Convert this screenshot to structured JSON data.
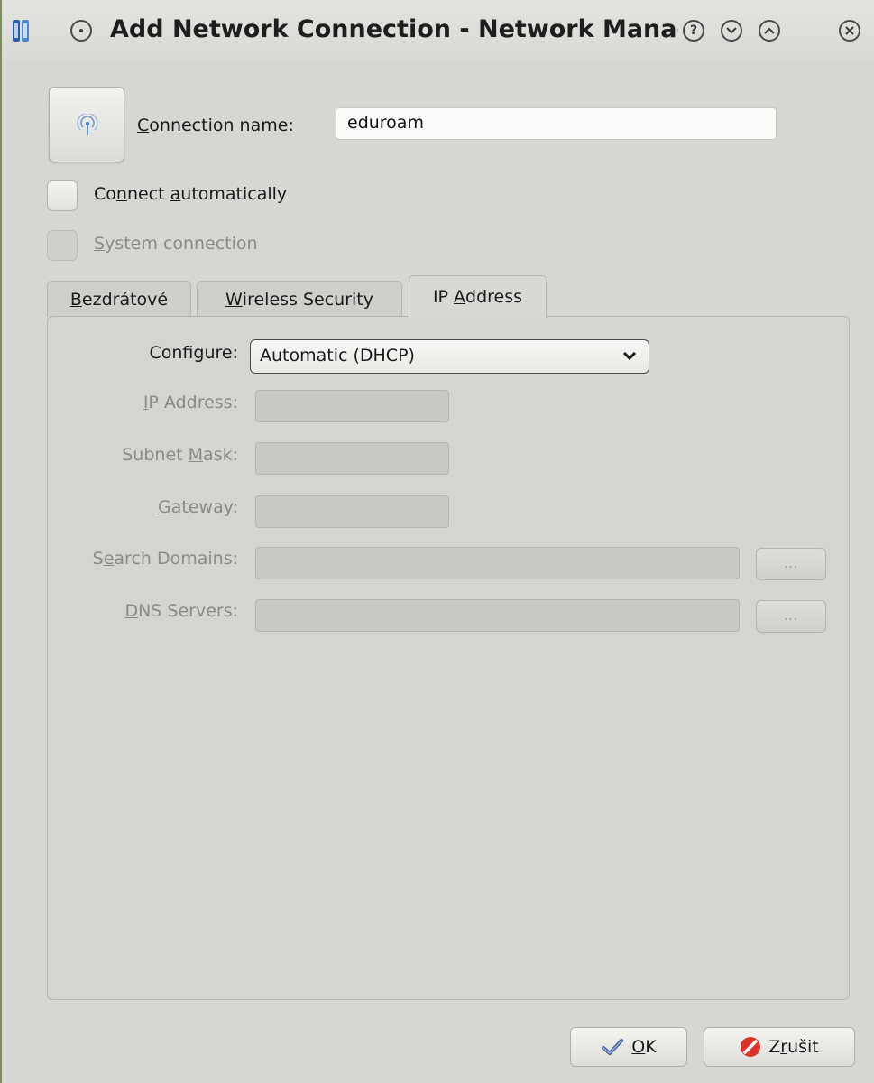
{
  "window": {
    "title": "Add Network Connection - Network Manag",
    "icons": [
      "app-icon",
      "menu-icon",
      "help-icon",
      "minimize-icon",
      "maximize-icon",
      "close-icon"
    ]
  },
  "connection": {
    "icon": "wireless-icon",
    "name_label_u": "C",
    "name_label_rest": "onnection name:",
    "name_value": "eduroam"
  },
  "options": {
    "connect_auto_pre": "Co",
    "connect_auto_u1": "n",
    "connect_auto_mid": "nect ",
    "connect_auto_u2": "a",
    "connect_auto_post": "utomatically",
    "system_conn_u": "S",
    "system_conn_rest": "ystem connection"
  },
  "tabs": [
    {
      "u": "B",
      "rest": "ezdrátové"
    },
    {
      "u": "W",
      "rest": "ireless Security"
    },
    {
      "pre": "IP ",
      "u": "A",
      "rest": "ddress"
    }
  ],
  "ip_form": {
    "configure_label": "Configure:",
    "configure_value": "Automatic (DHCP)",
    "ip_label_u": "I",
    "ip_label_rest": "P Address:",
    "subnet_label_pre": "Subnet ",
    "subnet_label_u": "M",
    "subnet_label_rest": "ask:",
    "gateway_label_u": "G",
    "gateway_label_rest": "ateway:",
    "search_label_pre": "S",
    "search_label_u": "e",
    "search_label_rest": "arch Domains:",
    "dns_label_u": "D",
    "dns_label_rest": "NS Servers:",
    "dots": "..."
  },
  "buttons": {
    "ok_u": "O",
    "ok_rest": "K",
    "cancel_pre": "Z",
    "cancel_u": "r",
    "cancel_rest": "ušit"
  },
  "colors": {
    "window_bg": "#d6d6d2",
    "frame_green": "#7d8c63",
    "cancel_red": "#d9342b",
    "ok_blue": "#3d5a99"
  }
}
